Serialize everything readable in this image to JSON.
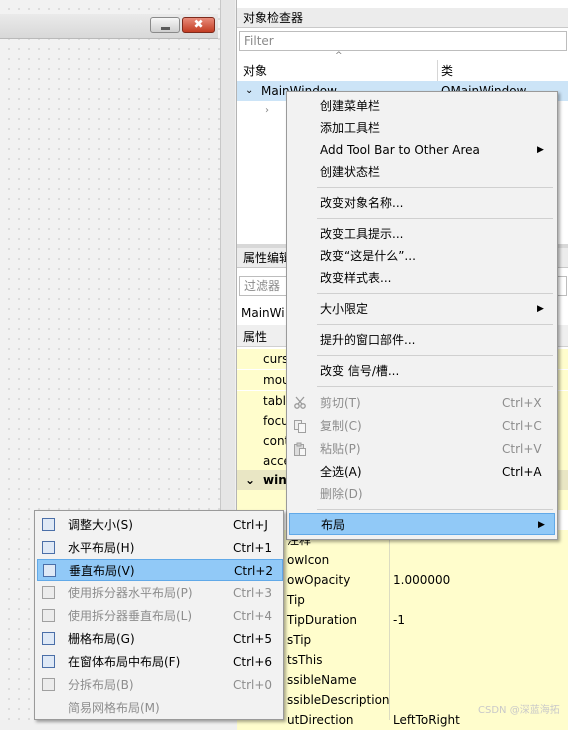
{
  "form": {
    "minimize": "▬",
    "close": "✖"
  },
  "object_inspector": {
    "title": "对象检查器",
    "filter_placeholder": "Filter",
    "col_object": "对象",
    "col_class": "类",
    "root_name": "MainWindow",
    "root_class": "QMainWindow"
  },
  "property_editor": {
    "title": "属性编辑",
    "filter_placeholder": "过滤器",
    "object_line": "MainWi",
    "col_property": "属性",
    "rows": [
      {
        "name": "curs",
        "value": ""
      },
      {
        "name": "mou",
        "value": ""
      },
      {
        "name": "tabl",
        "value": ""
      },
      {
        "name": "focu",
        "value": ""
      },
      {
        "name": "cont",
        "value": ""
      },
      {
        "name": "acce",
        "value": ""
      },
      {
        "name": "win",
        "value": ""
      }
    ],
    "lower_rows": [
      {
        "name": "注释",
        "value": ""
      },
      {
        "name": "owIcon",
        "value": ""
      },
      {
        "name": "owOpacity",
        "value": "1.000000"
      },
      {
        "name": "Tip",
        "value": ""
      },
      {
        "name": "TipDuration",
        "value": "-1"
      },
      {
        "name": "sTip",
        "value": ""
      },
      {
        "name": "tsThis",
        "value": ""
      },
      {
        "name": "ssibleName",
        "value": ""
      },
      {
        "name": "ssibleDescription",
        "value": ""
      },
      {
        "name": "utDirection",
        "value": "LeftToRight"
      }
    ]
  },
  "context_menu": {
    "items": [
      {
        "label": "创建菜单栏",
        "shortcut": ""
      },
      {
        "label": "添加工具栏",
        "shortcut": ""
      },
      {
        "label": "Add Tool Bar to Other Area",
        "shortcut": "",
        "arrow": "▶"
      },
      {
        "label": "创建状态栏",
        "shortcut": ""
      },
      {
        "label": "改变对象名称...",
        "shortcut": ""
      },
      {
        "label": "改变工具提示...",
        "shortcut": ""
      },
      {
        "label": "改变“这是什么”...",
        "shortcut": ""
      },
      {
        "label": "改变样式表...",
        "shortcut": ""
      },
      {
        "label": "大小限定",
        "shortcut": "",
        "arrow": "▶"
      },
      {
        "label": "提升的窗口部件...",
        "shortcut": ""
      },
      {
        "label": "改变 信号/槽...",
        "shortcut": ""
      },
      {
        "label": "剪切(T)",
        "shortcut": "Ctrl+X"
      },
      {
        "label": "复制(C)",
        "shortcut": "Ctrl+C"
      },
      {
        "label": "粘贴(P)",
        "shortcut": "Ctrl+V"
      },
      {
        "label": "全选(A)",
        "shortcut": "Ctrl+A"
      },
      {
        "label": "删除(D)",
        "shortcut": ""
      },
      {
        "label": "布局",
        "shortcut": "",
        "arrow": "▶"
      }
    ]
  },
  "layout_menu": {
    "items": [
      {
        "label": "调整大小(S)",
        "shortcut": "Ctrl+J"
      },
      {
        "label": "水平布局(H)",
        "shortcut": "Ctrl+1"
      },
      {
        "label": "垂直布局(V)",
        "shortcut": "Ctrl+2"
      },
      {
        "label": "使用拆分器水平布局(P)",
        "shortcut": "Ctrl+3"
      },
      {
        "label": "使用拆分器垂直布局(L)",
        "shortcut": "Ctrl+4"
      },
      {
        "label": "栅格布局(G)",
        "shortcut": "Ctrl+5"
      },
      {
        "label": "在窗体布局中布局(F)",
        "shortcut": "Ctrl+6"
      },
      {
        "label": "分拆布局(B)",
        "shortcut": "Ctrl+0"
      },
      {
        "label": "简易网格布局(M)",
        "shortcut": ""
      }
    ]
  },
  "watermark": "CSDN @深蓝海拓"
}
